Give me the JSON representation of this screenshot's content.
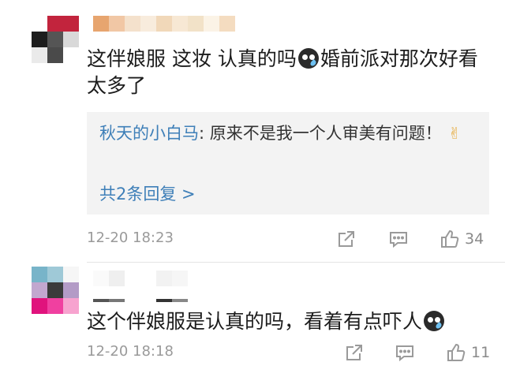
{
  "comments": [
    {
      "text_part1": "这伴娘服 这妆 认真的吗",
      "text_part2": "婚前派对那次好看太多了",
      "emoji_icon": "crying-face-icon",
      "reply": {
        "author": "秋天的小白马",
        "text": ": 原来不是我一个人审美有问题！",
        "emoji_icon": "victory-hand-icon",
        "more": "共2条回复 >"
      },
      "time": "12-20 18:23",
      "likes": "34"
    },
    {
      "text": "这个伴娘服是认真的吗，看着有点吓人",
      "emoji_icon": "crying-face-icon",
      "time": "12-20 18:18",
      "likes": "11"
    }
  ],
  "colors": {
    "link": "#3e7fb8",
    "meta": "#9a9a9a",
    "reply_bg": "#f3f3f3"
  }
}
